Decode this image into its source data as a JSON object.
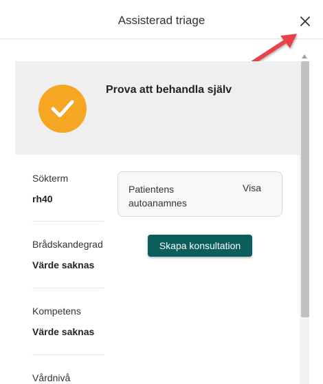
{
  "header": {
    "title": "Assisterad triage"
  },
  "icons": {
    "cursor": "mouse-pointer-icon",
    "close": "close-icon",
    "arrow": "red-arrow-icon",
    "check": "checkmark-icon"
  },
  "colors": {
    "accent": "#f5a623",
    "primary_button": "#0b5e5c",
    "banner_bg": "#efefef",
    "arrow": "#e8434a"
  },
  "banner": {
    "title": "Prova att behandla själv"
  },
  "fields": [
    {
      "label": "Sökterm",
      "value": "rh40"
    },
    {
      "label": "Brådskandegrad",
      "value": "Värde saknas"
    },
    {
      "label": "Kompetens",
      "value": "Värde saknas"
    },
    {
      "label": "Vårdnivå",
      "value": ""
    }
  ],
  "card": {
    "text": "Patientens autoanamnes",
    "link": "Visa"
  },
  "actions": {
    "create_consultation": "Skapa konsultation"
  }
}
